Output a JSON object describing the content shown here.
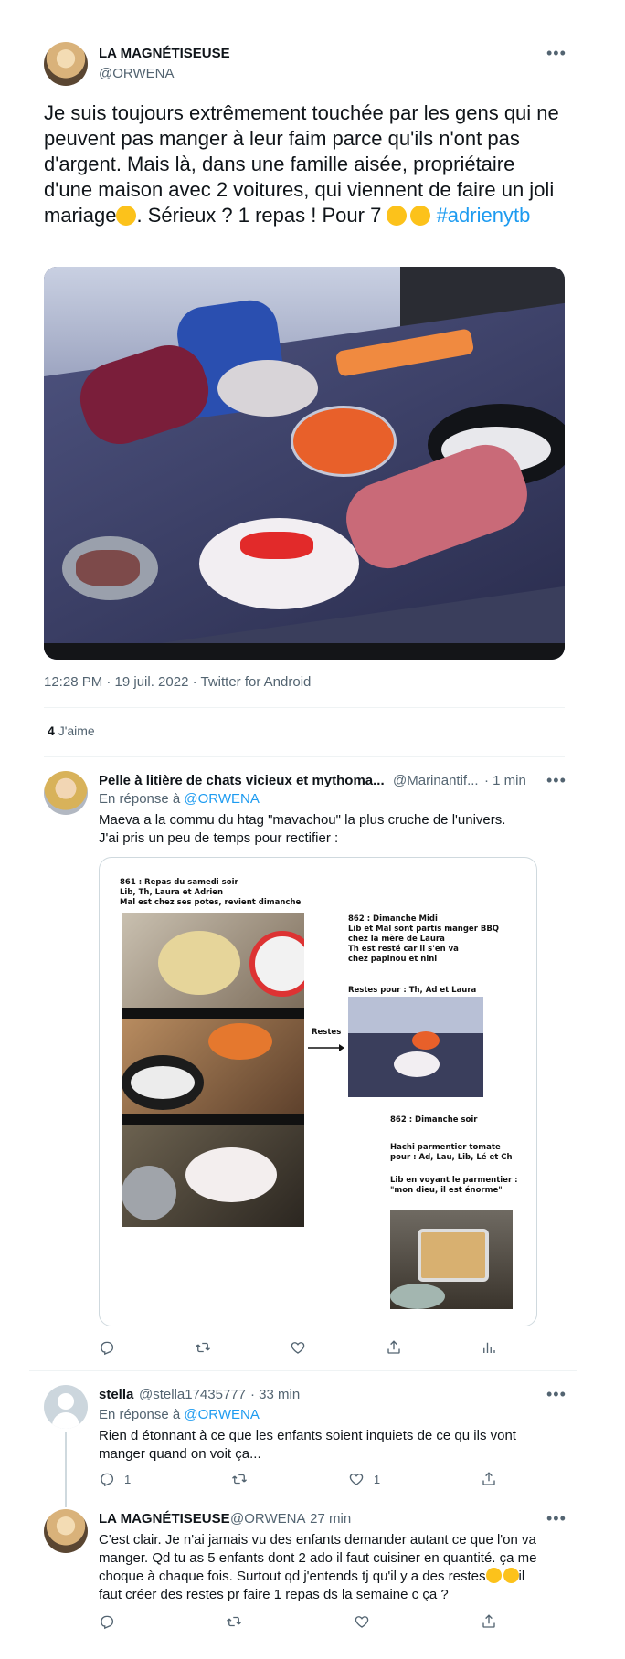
{
  "main_tweet": {
    "author_name": "LA MAGNÉTISEUSE",
    "handle": "@ORWENA",
    "text_before_emoji": "Je suis toujours extrêmement touchée par les gens qui ne peuvent pas manger à leur faim parce qu'ils n'ont pas d'argent. Mais là, dans une famille aisée, propriétaire d'une maison avec 2 voitures, qui viennent de faire un joli mariage",
    "text_after_emoji": ".  Sérieux ? 1 repas ! Pour 7",
    "hashtag": "#adrienytb",
    "timestamp": "12:28 PM · 19 juil. 2022 · Twitter for Android",
    "likes_count": "4",
    "likes_label": "J'aime"
  },
  "reply1": {
    "author_name": "Pelle à litière de chats vicieux et mythoma...",
    "handle": "@Marinantif...",
    "time": "· 1 min",
    "reply_to_prefix": "En réponse à",
    "reply_to": "@ORWENA",
    "text_line1": "Maeva a la commu du htag \"mavachou\" la plus cruche de l'univers.",
    "text_line2": "J'ai pris un peu de temps pour rectifier :",
    "doc": {
      "block1": [
        "861 : Repas du samedi soir",
        "Lib, Th, Laura et Adrien",
        "Mal est chez ses potes, revient dimanche"
      ],
      "block2": [
        "862 : Dimanche Midi",
        "Lib et Mal sont partis manger BBQ",
        "chez la mère de Laura",
        "Th est resté car il s'en va",
        "chez papinou et nini"
      ],
      "block3": "Restes pour : Th, Ad et Laura",
      "arrow_label": "Restes",
      "block4": "862 : Dimanche soir",
      "block5": [
        "Hachi parmentier tomate",
        "pour : Ad, Lau, Lib, Lé et Ch"
      ],
      "block6": [
        "Lib en voyant le parmentier :",
        "\"mon dieu, il est énorme\""
      ]
    }
  },
  "reply2": {
    "author_name": "stella",
    "handle": "@stella17435777",
    "time": "· 33 min",
    "reply_to_prefix": "En réponse à",
    "reply_to": "@ORWENA",
    "text": "Rien d étonnant à ce que les enfants soient inquiets de ce qu ils vont manger quand on voit ça...",
    "reply_count": "1",
    "like_count": "1"
  },
  "reply3": {
    "author_name": "LA MAGNÉTISEUSE",
    "handle": "@ORWENA",
    "time": "· 27 min",
    "text": "C'est clair. Je n'ai jamais vu des enfants demander autant ce que l'on va manger. Qd tu as 5 enfants dont 2 ado il faut cuisiner en quantité. ça me choque à chaque fois. Surtout qd j'entends tj qu'il y a des restes",
    "text_end": "il faut créer des restes pr faire 1 repas ds la semaine c ça ?"
  },
  "icons": [
    "more-icon",
    "reply-icon",
    "retweet-icon",
    "like-icon",
    "share-icon",
    "analytics-icon"
  ],
  "colors": {
    "link": "#1d9bf0",
    "muted": "#536471",
    "divider": "#eff3f4"
  }
}
